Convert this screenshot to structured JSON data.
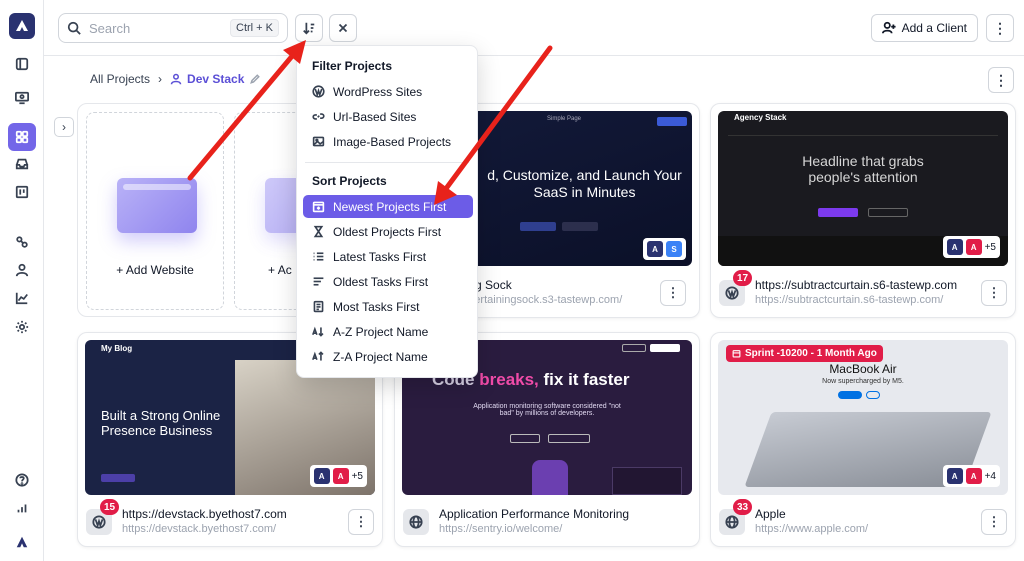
{
  "topbar": {
    "search_placeholder": "Search",
    "search_shortcut": "Ctrl + K",
    "add_client_label": "Add a Client"
  },
  "breadcrumb": {
    "root": "All Projects",
    "current": "Dev Stack"
  },
  "add_cards": {
    "add_website": "Add Website",
    "add_other_partial": "Ac"
  },
  "dropdown": {
    "filter_title": "Filter Projects",
    "filter_items": [
      "WordPress Sites",
      "Url-Based Sites",
      "Image-Based Projects"
    ],
    "sort_title": "Sort Projects",
    "sort_items": [
      "Newest Projects First",
      "Oldest Projects First",
      "Latest Tasks First",
      "Oldest Tasks First",
      "Most Tasks First",
      "A-Z Project Name",
      "Z-A Project Name"
    ],
    "selected": "Newest Projects First"
  },
  "projects": [
    {
      "title_partial": "ning Sock",
      "url_partial": "entertainingsock.s3-tastewp.com/",
      "thumb_headline": "d, Customize, and Launch Your SaaS in Minutes",
      "thumb_nav": "Simple Page"
    },
    {
      "title": "https://subtractcurtain.s6-tastewp.com",
      "url": "https://subtractcurtain.s6-tastewp.com/",
      "badge": "17",
      "more_count": "+5",
      "thumb_brand": "Agency Stack",
      "thumb_headline": "Headline that grabs people's attention"
    },
    {
      "title": "https://devstack.byethost7.com",
      "url": "https://devstack.byethost7.com/",
      "badge": "15",
      "more_count": "+5",
      "thumb_brand": "My Blog",
      "thumb_headline": "Built a Strong Online Presence Business"
    },
    {
      "title": "Application Performance Monitoring",
      "url": "https://sentry.io/welcome/",
      "thumb_headline_a": "Code",
      "thumb_headline_b": "breaks,",
      "thumb_headline_c": "fix it faster",
      "thumb_sub": "Application monitoring software considered \"not bad\" by millions of developers."
    },
    {
      "title": "Apple",
      "url": "https://www.apple.com/",
      "badge": "33",
      "more_count": "+4",
      "sprint_label": "Sprint -10200 - 1 Month Ago",
      "thumb_headline": "MacBook Air",
      "thumb_sub": "Now supercharged by M5."
    }
  ],
  "colors": {
    "accent": "#6c5ce7",
    "badge": "#e11d48",
    "arrow": "#e8221b",
    "logo_bg": "#2a3270"
  }
}
